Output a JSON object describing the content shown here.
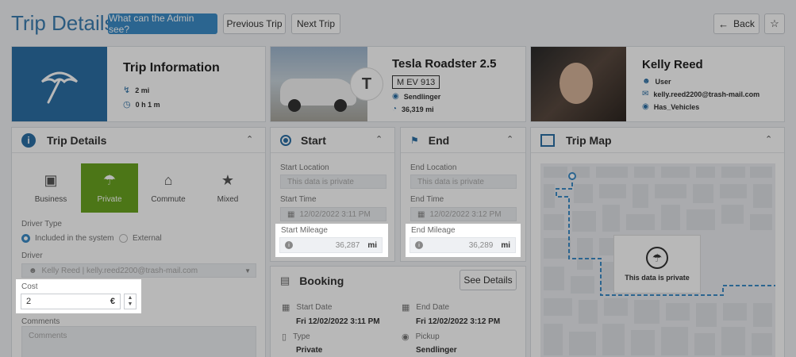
{
  "header": {
    "title": "Trip Details",
    "admin_button": "What can the Admin see?",
    "prev_button": "Previous Trip",
    "next_button": "Next Trip",
    "back_button": "Back"
  },
  "trip_info": {
    "title": "Trip Information",
    "distance": "2 mi",
    "duration": "0 h 1 m"
  },
  "vehicle": {
    "name": "Tesla Roadster 2.5",
    "plate": "M EV 913",
    "location": "Sendlinger",
    "odometer": "36,319 mi"
  },
  "user": {
    "name": "Kelly Reed",
    "role": "User",
    "email": "kelly.reed2200@trash-mail.com",
    "group": "Has_Vehicles"
  },
  "trip_details": {
    "title": "Trip Details",
    "types": [
      "Business",
      "Private",
      "Commute",
      "Mixed"
    ],
    "driver_type_label": "Driver Type",
    "driver_type_options": [
      "Included in the system",
      "External"
    ],
    "driver_label": "Driver",
    "driver_value": "Kelly Reed | kelly.reed2200@trash-mail.com",
    "cost_label": "Cost",
    "cost_value": "2",
    "cost_currency": "€",
    "comments_label": "Comments",
    "comments_placeholder": "Comments"
  },
  "start": {
    "title": "Start",
    "location_label": "Start Location",
    "location_value": "This data is private",
    "time_label": "Start Time",
    "time_value": "12/02/2022 3:11 PM",
    "mileage_label": "Start Mileage",
    "mileage_value": "36,287",
    "mileage_unit": "mi"
  },
  "end": {
    "title": "End",
    "location_label": "End Location",
    "location_value": "This data is private",
    "time_label": "End Time",
    "time_value": "12/02/2022 3:12 PM",
    "mileage_label": "End Mileage",
    "mileage_value": "36,289",
    "mileage_unit": "mi"
  },
  "booking": {
    "title": "Booking",
    "see_details": "See Details",
    "start_date_label": "Start Date",
    "start_date_value": "Fri 12/02/2022 3:11 PM",
    "end_date_label": "End Date",
    "end_date_value": "Fri 12/02/2022 3:12 PM",
    "type_label": "Type",
    "type_value": "Private",
    "pickup_label": "Pickup",
    "pickup_value": "Sendlinger"
  },
  "trip_map": {
    "title": "Trip Map",
    "private_text": "This data is private"
  },
  "colors": {
    "accent": "#3c8dc8",
    "private_green": "#6aa421",
    "trip_tile": "#2b6fa6"
  }
}
